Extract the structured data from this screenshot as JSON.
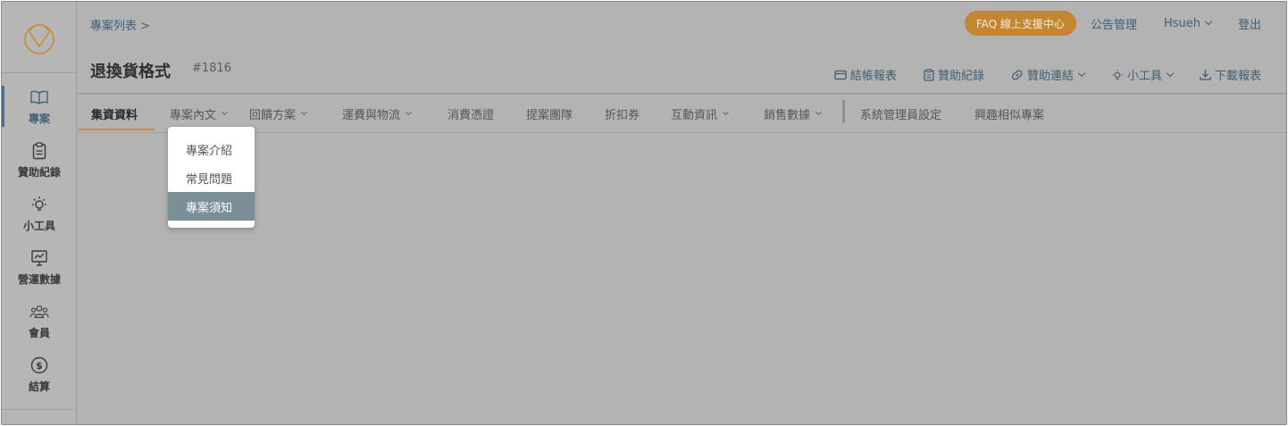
{
  "sidebar": {
    "items": [
      {
        "label": "專案",
        "icon": "book-icon",
        "active": true
      },
      {
        "label": "贊助紀錄",
        "icon": "clipboard-icon"
      },
      {
        "label": "小工具",
        "icon": "lightbulb-icon"
      },
      {
        "label": "營運數據",
        "icon": "chart-icon"
      },
      {
        "label": "會員",
        "icon": "users-icon"
      },
      {
        "label": "結算",
        "icon": "dollar-icon"
      }
    ]
  },
  "header": {
    "breadcrumb": "專案列表 >",
    "title": "退換貨格式",
    "id": "#1816",
    "faq_label": "FAQ 線上支援中心",
    "announcement_label": "公告管理",
    "user_label": "Hsueh",
    "logout_label": "登出"
  },
  "toolbar": {
    "settlement_report": "結帳報表",
    "sponsor_records": "贊助紀錄",
    "sponsor_link": "贊助連結",
    "tools": "小工具",
    "download_report": "下載報表"
  },
  "tabs": [
    {
      "label": "集資資料",
      "active": true
    },
    {
      "label": "專案內文",
      "dropdown": true
    },
    {
      "label": "回饋方案",
      "dropdown": true
    },
    {
      "label": "運費與物流",
      "dropdown": true
    },
    {
      "label": "消費憑證"
    },
    {
      "label": "提案團隊"
    },
    {
      "label": "折扣券"
    },
    {
      "label": "互動資訊",
      "dropdown": true
    },
    {
      "label": "銷售數據",
      "dropdown": true
    },
    {
      "label": "系統管理員設定"
    },
    {
      "label": "興趣相似專案"
    }
  ],
  "dropdown": {
    "items": [
      {
        "label": "專案介紹"
      },
      {
        "label": "常見問題"
      },
      {
        "label": "專案須知",
        "selected": true
      }
    ]
  },
  "colors": {
    "accent": "#c48630",
    "link": "#3f5f75",
    "selected": "#7b8f99"
  }
}
